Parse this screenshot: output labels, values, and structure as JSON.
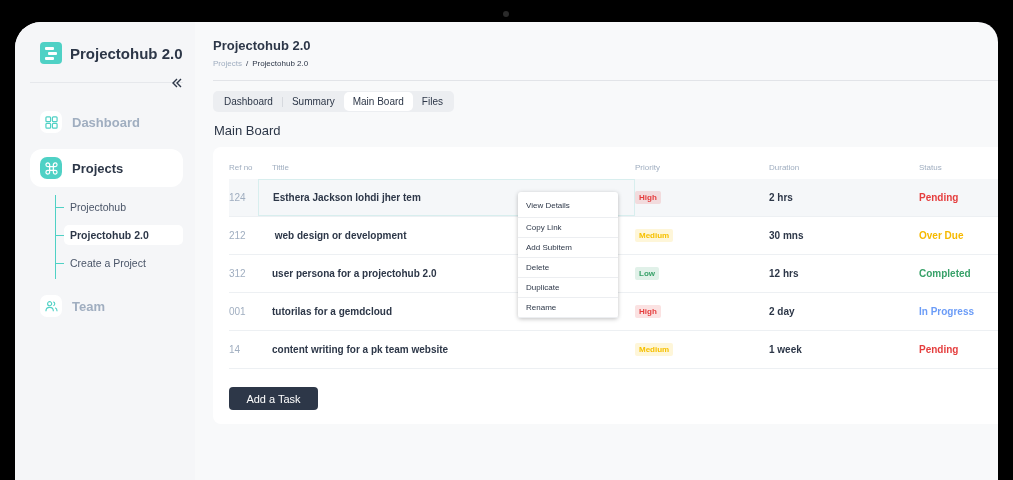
{
  "sidebar": {
    "app_name": "Projectohub 2.0",
    "items": [
      {
        "label": "Dashboard",
        "selected": false
      },
      {
        "label": "Projects",
        "selected": true,
        "children": [
          {
            "label": "Projectohub",
            "selected": false
          },
          {
            "label": "Projectohub 2.0",
            "selected": true
          },
          {
            "label": "Create a Project",
            "selected": false
          }
        ]
      },
      {
        "label": "Team",
        "selected": false
      }
    ]
  },
  "header": {
    "title": "Projectohub 2.0",
    "breadcrumb": [
      "Projects",
      "Projectohub 2.0"
    ],
    "breadcrumb_separator": "/"
  },
  "tabs": [
    {
      "label": "Dashboard",
      "selected": false
    },
    {
      "label": "Summary",
      "selected": false
    },
    {
      "label": "Main Board",
      "selected": true
    },
    {
      "label": "Files",
      "selected": false
    }
  ],
  "section_title": "Main Board",
  "table": {
    "columns": [
      "Ref no",
      "Tittle",
      "Priority",
      "Duration",
      "Status"
    ],
    "rows": [
      {
        "ref": "124",
        "title": "Esthera Jackson lohdi jher tem",
        "priority": {
          "label": "High",
          "color": "#e53e3e"
        },
        "duration": "2 hrs",
        "status": {
          "label": "Pending",
          "color": "#e53e3e"
        },
        "selected": true
      },
      {
        "ref": "212",
        "title": " web design or development",
        "priority": {
          "label": "Medium",
          "color": "#f6c000"
        },
        "duration": "30 mns",
        "status": {
          "label": "Over Due",
          "color": "#f6b900"
        },
        "selected": false
      },
      {
        "ref": "312",
        "title": "user persona for a projectohub 2.0",
        "priority": {
          "label": "Low",
          "color": "#38a169"
        },
        "duration": "12 hrs",
        "status": {
          "label": "Completed",
          "color": "#38a169"
        },
        "selected": false
      },
      {
        "ref": "001",
        "title": "tutorilas for a gemdcloud",
        "priority": {
          "label": "High",
          "color": "#e53e3e"
        },
        "duration": "2 day",
        "status": {
          "label": "In Progress",
          "color": "#6b9cf7"
        },
        "selected": false
      },
      {
        "ref": "14",
        "title": "content writing for a pk team website",
        "priority": {
          "label": "Medium",
          "color": "#f6c000"
        },
        "duration": "1 week",
        "status": {
          "label": "Pending",
          "color": "#e53e3e"
        },
        "selected": false
      }
    ]
  },
  "context_menu": [
    "View Details",
    "Copy Link",
    "Add Subitem",
    "Delete",
    "Duplicate",
    "Rename"
  ],
  "add_button": "Add a Task"
}
